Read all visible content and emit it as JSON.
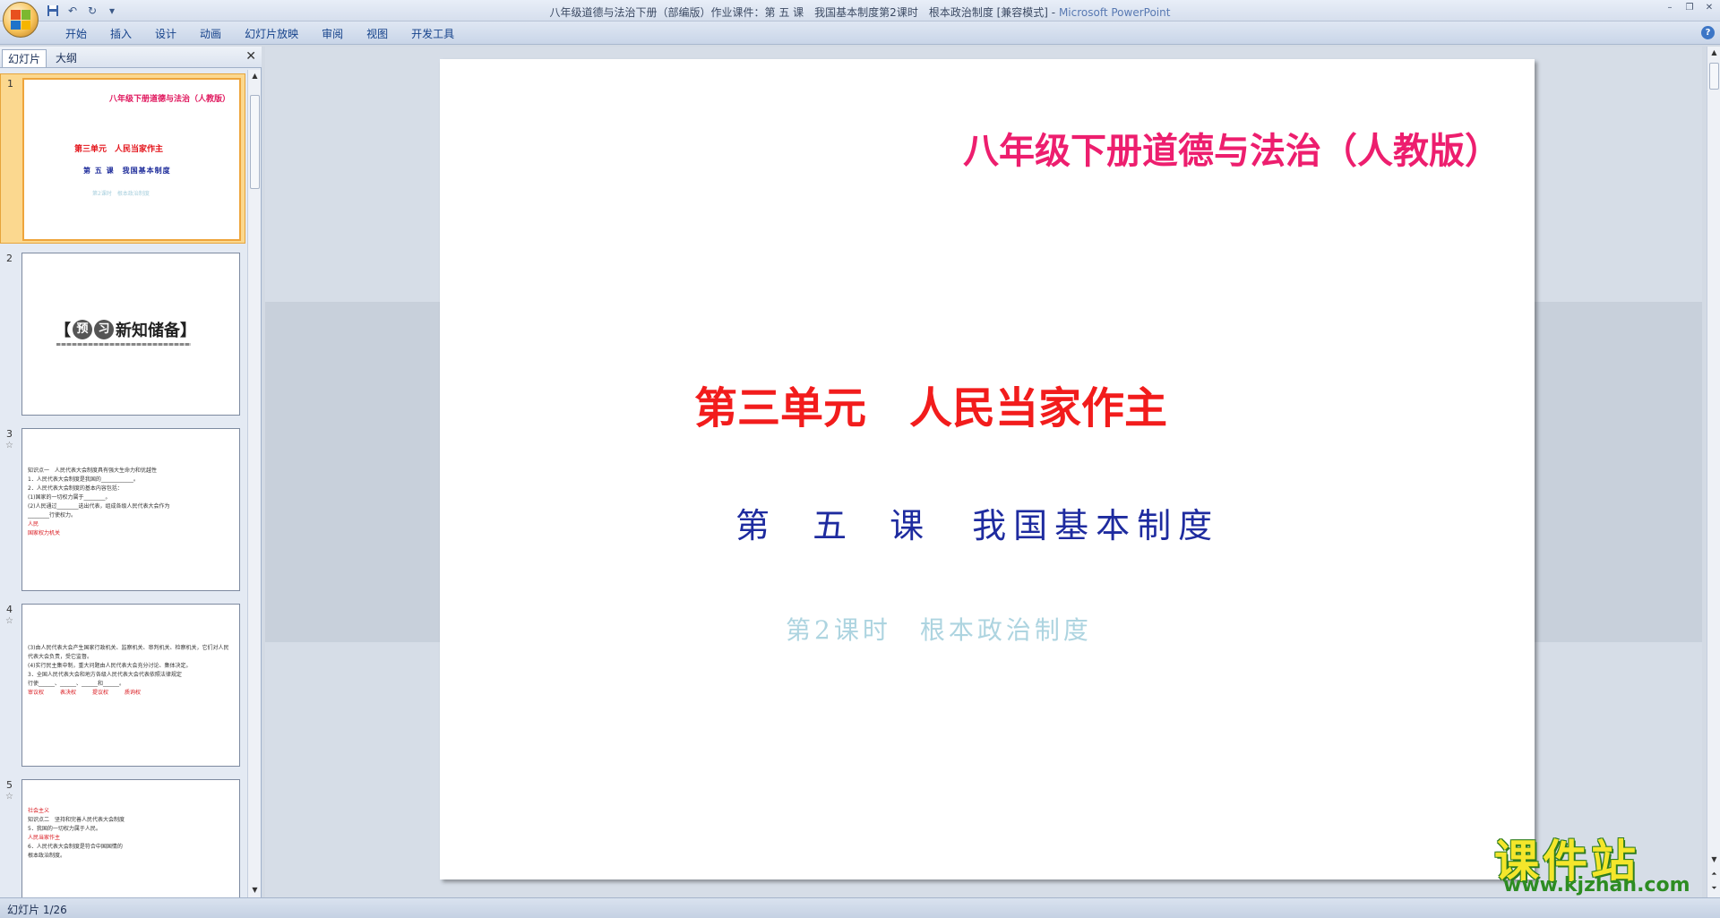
{
  "window": {
    "title": "八年级道德与法治下册（部编版）作业课件：第 五 课　我国基本制度第2课时　根本政治制度 [兼容模式] - ",
    "app_name": "Microsoft PowerPoint"
  },
  "ribbon": {
    "tabs": [
      "开始",
      "插入",
      "设计",
      "动画",
      "幻灯片放映",
      "审阅",
      "视图",
      "开发工具"
    ]
  },
  "panel": {
    "tab_slides": "幻灯片",
    "tab_outline": "大纲"
  },
  "thumbnails": [
    {
      "number": "1",
      "title": "八年级下册道德与法治（人教版）",
      "unit": "第三单元　人民当家作主",
      "lesson": "第 五 课　我国基本制度",
      "period": "第2课时　根本政治制度"
    },
    {
      "number": "2",
      "heading_pre": "【",
      "c1": "预",
      "c2": "习",
      "heading_post": "新知储备】"
    },
    {
      "number": "3",
      "lines": [
        "知识点一　人民代表大会制度具有强大生命力和优越性",
        "1．人民代表大会制度是我国的____________。",
        "2．人民代表大会制度的基本内容包括：",
        "(1)国家的一切权力属于________。",
        "(2)人民通过________选出代表，组成各级人民代表大会作为",
        "________行使权力。"
      ],
      "marks": [
        "人民",
        "国家权力机关"
      ]
    },
    {
      "number": "4",
      "lines": [
        "(3)由人民代表大会产生国家行政机关、监察机关、审判机关、检察机关，它们对人民代表大会负责，受它监督。",
        "(4)实行民主集中制，重大问题由人民代表大会充分讨论、集体决定。",
        "3．全国人民代表大会和地方各级人民代表大会代表依照法律规定",
        "行使______、______、______和______。"
      ],
      "marks": [
        "审议权",
        "表决权",
        "提议权",
        "质询权"
      ]
    },
    {
      "number": "5",
      "lines": [
        "知识点二　坚持和完善人民代表大会制度",
        "5．我国的一切权力属于人民。",
        "6．人民代表大会制度是符合中国国情的",
        "根本政治制度。"
      ],
      "marks": [
        "社会主义",
        "人民当家作主"
      ]
    }
  ],
  "slide": {
    "title": "八年级下册道德与法治（人教版）",
    "unit": "第三单元　人民当家作主",
    "lesson": "第 五 课　我国基本制度",
    "period": "第2课时　根本政治制度"
  },
  "watermark": {
    "text": "课件站",
    "url": "www.kjzhan.com"
  },
  "status": {
    "slide_indicator": "幻灯片 1/26"
  },
  "colors": {
    "title_pink": "#ed1e6e",
    "unit_red": "#f21c1c",
    "lesson_blue": "#1e2b9f",
    "period_lightblue": "#add4e0",
    "selected_thumb": "#fbd88f"
  }
}
